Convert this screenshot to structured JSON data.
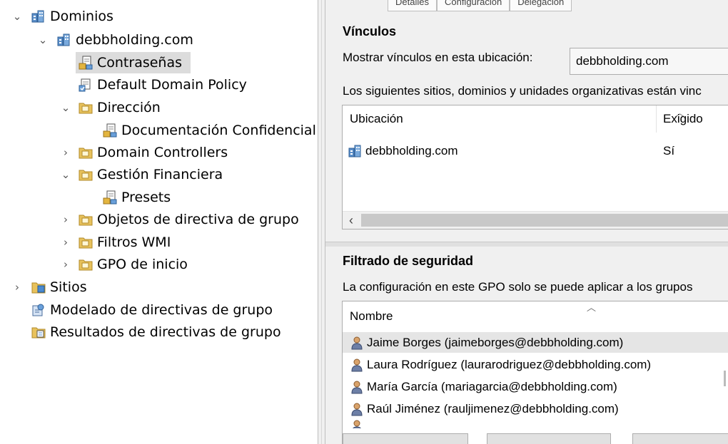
{
  "tree": {
    "items": [
      {
        "label": "Dominios"
      },
      {
        "label": "debbholding.com"
      },
      {
        "label": "Contraseñas"
      },
      {
        "label": "Default Domain Policy"
      },
      {
        "label": "Dirección"
      },
      {
        "label": "Documentación Confidencial"
      },
      {
        "label": "Domain Controllers"
      },
      {
        "label": "Gestión Financiera"
      },
      {
        "label": "Presets"
      },
      {
        "label": "Objetos de directiva de grupo"
      },
      {
        "label": "Filtros WMI"
      },
      {
        "label": "GPO de inicio"
      },
      {
        "label": "Sitios"
      },
      {
        "label": "Modelado de directivas de grupo"
      },
      {
        "label": "Resultados de directivas de grupo"
      }
    ]
  },
  "tabs": [
    "Detalles",
    "Configuración",
    "Delegación"
  ],
  "links": {
    "title": "Vínculos",
    "show_label": "Mostrar vínculos en esta ubicación:",
    "location_value": "debbholding.com",
    "description": "Los siguientes sitios, dominios y unidades organizativas están vinc",
    "columns": [
      "Ubicación",
      "Exigido"
    ],
    "rows": [
      {
        "location": "debbholding.com",
        "enforced": "Sí"
      }
    ]
  },
  "security": {
    "title": "Filtrado de seguridad",
    "description": "La configuración en este GPO solo se puede aplicar a los grupos",
    "column": "Nombre",
    "rows": [
      "Jaime Borges (jaimeborges@debbholding.com)",
      "Laura Rodríguez (laurarodriguez@debbholding.com)",
      "María García (mariagarcia@debbholding.com)",
      "Raúl Jiménez (rauljimenez@debbholding.com)"
    ]
  }
}
